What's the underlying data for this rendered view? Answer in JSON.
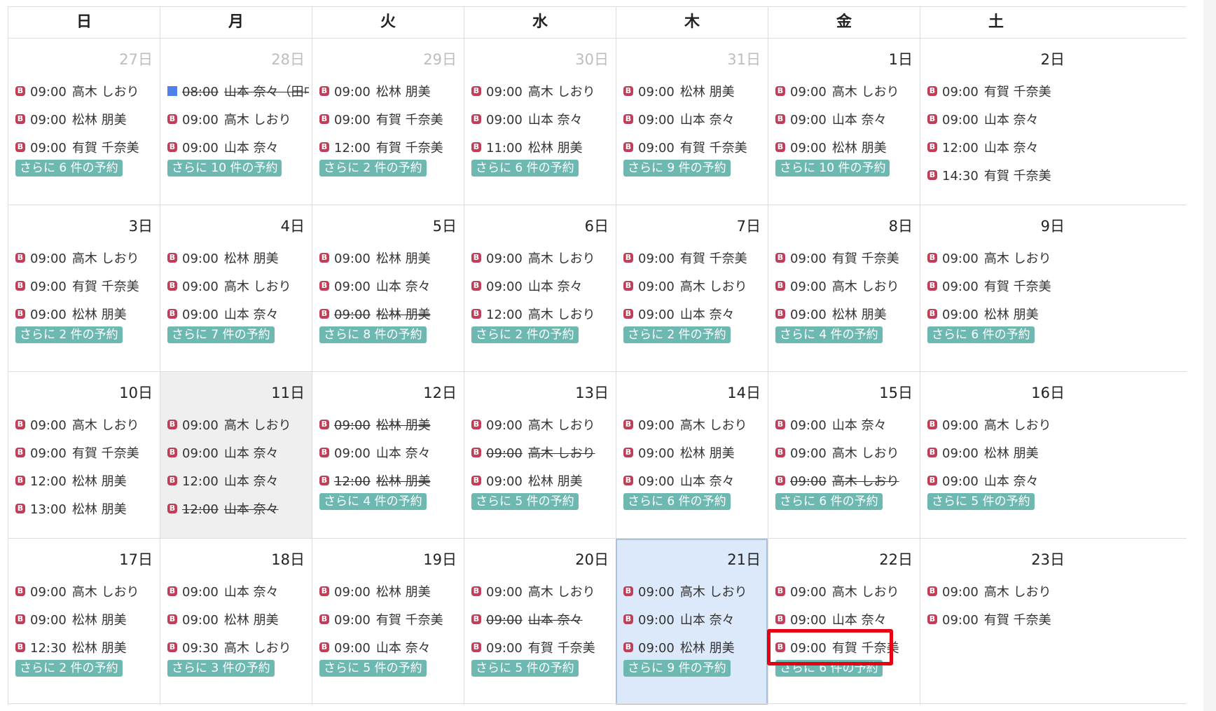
{
  "weekdays": [
    "日",
    "月",
    "火",
    "水",
    "木",
    "金",
    "土"
  ],
  "weeks": [
    [
      {
        "day": "27日",
        "other": true,
        "events": [
          {
            "icon": "b",
            "time": "09:00",
            "name": "高木 しおり"
          },
          {
            "icon": "b",
            "time": "09:00",
            "name": "松林 朋美"
          },
          {
            "icon": "b",
            "time": "09:00",
            "name": "有賀 千奈美"
          }
        ],
        "more": "さらに 6 件の予約"
      },
      {
        "day": "28日",
        "other": true,
        "events": [
          {
            "icon": "sq",
            "time": "08:00",
            "name": "山本 奈々（田中三",
            "cancelled": true
          },
          {
            "icon": "b",
            "time": "09:00",
            "name": "高木 しおり"
          },
          {
            "icon": "b",
            "time": "09:00",
            "name": "山本 奈々"
          }
        ],
        "more": "さらに 10 件の予約"
      },
      {
        "day": "29日",
        "other": true,
        "events": [
          {
            "icon": "b",
            "time": "09:00",
            "name": "松林 朋美"
          },
          {
            "icon": "b",
            "time": "09:00",
            "name": "有賀 千奈美"
          },
          {
            "icon": "b",
            "time": "12:00",
            "name": "有賀 千奈美"
          }
        ],
        "more": "さらに 2 件の予約"
      },
      {
        "day": "30日",
        "other": true,
        "events": [
          {
            "icon": "b",
            "time": "09:00",
            "name": "高木 しおり"
          },
          {
            "icon": "b",
            "time": "09:00",
            "name": "山本 奈々"
          },
          {
            "icon": "b",
            "time": "11:00",
            "name": "松林 朋美"
          }
        ],
        "more": "さらに 6 件の予約"
      },
      {
        "day": "31日",
        "other": true,
        "events": [
          {
            "icon": "b",
            "time": "09:00",
            "name": "松林 朋美"
          },
          {
            "icon": "b",
            "time": "09:00",
            "name": "山本 奈々"
          },
          {
            "icon": "b",
            "time": "09:00",
            "name": "有賀 千奈美"
          }
        ],
        "more": "さらに 9 件の予約"
      },
      {
        "day": "1日",
        "events": [
          {
            "icon": "b",
            "time": "09:00",
            "name": "高木 しおり"
          },
          {
            "icon": "b",
            "time": "09:00",
            "name": "山本 奈々"
          },
          {
            "icon": "b",
            "time": "09:00",
            "name": "松林 朋美"
          }
        ],
        "more": "さらに 10 件の予約"
      },
      {
        "day": "2日",
        "events": [
          {
            "icon": "b",
            "time": "09:00",
            "name": "有賀 千奈美"
          },
          {
            "icon": "b",
            "time": "09:00",
            "name": "山本 奈々"
          },
          {
            "icon": "b",
            "time": "12:00",
            "name": "山本 奈々"
          },
          {
            "icon": "b",
            "time": "14:30",
            "name": "有賀 千奈美"
          }
        ]
      }
    ],
    [
      {
        "day": "3日",
        "events": [
          {
            "icon": "b",
            "time": "09:00",
            "name": "高木 しおり"
          },
          {
            "icon": "b",
            "time": "09:00",
            "name": "有賀 千奈美"
          },
          {
            "icon": "b",
            "time": "09:00",
            "name": "松林 朋美"
          }
        ],
        "more": "さらに 2 件の予約"
      },
      {
        "day": "4日",
        "events": [
          {
            "icon": "b",
            "time": "09:00",
            "name": "松林 朋美"
          },
          {
            "icon": "b",
            "time": "09:00",
            "name": "高木 しおり"
          },
          {
            "icon": "b",
            "time": "09:00",
            "name": "山本 奈々"
          }
        ],
        "more": "さらに 7 件の予約"
      },
      {
        "day": "5日",
        "events": [
          {
            "icon": "b",
            "time": "09:00",
            "name": "松林 朋美"
          },
          {
            "icon": "b",
            "time": "09:00",
            "name": "山本 奈々"
          },
          {
            "icon": "b",
            "time": "09:00",
            "name": "松林 朋美",
            "cancelled": true
          }
        ],
        "more": "さらに 8 件の予約"
      },
      {
        "day": "6日",
        "events": [
          {
            "icon": "b",
            "time": "09:00",
            "name": "高木 しおり"
          },
          {
            "icon": "b",
            "time": "09:00",
            "name": "山本 奈々"
          },
          {
            "icon": "b",
            "time": "12:00",
            "name": "高木 しおり"
          }
        ],
        "more": "さらに 2 件の予約"
      },
      {
        "day": "7日",
        "events": [
          {
            "icon": "b",
            "time": "09:00",
            "name": "有賀 千奈美"
          },
          {
            "icon": "b",
            "time": "09:00",
            "name": "高木 しおり"
          },
          {
            "icon": "b",
            "time": "09:00",
            "name": "山本 奈々"
          }
        ],
        "more": "さらに 2 件の予約"
      },
      {
        "day": "8日",
        "events": [
          {
            "icon": "b",
            "time": "09:00",
            "name": "有賀 千奈美"
          },
          {
            "icon": "b",
            "time": "09:00",
            "name": "高木 しおり"
          },
          {
            "icon": "b",
            "time": "09:00",
            "name": "松林 朋美"
          }
        ],
        "more": "さらに 4 件の予約"
      },
      {
        "day": "9日",
        "events": [
          {
            "icon": "b",
            "time": "09:00",
            "name": "高木 しおり"
          },
          {
            "icon": "b",
            "time": "09:00",
            "name": "有賀 千奈美"
          },
          {
            "icon": "b",
            "time": "09:00",
            "name": "松林 朋美"
          }
        ],
        "more": "さらに 6 件の予約"
      }
    ],
    [
      {
        "day": "10日",
        "events": [
          {
            "icon": "b",
            "time": "09:00",
            "name": "高木 しおり"
          },
          {
            "icon": "b",
            "time": "09:00",
            "name": "有賀 千奈美"
          },
          {
            "icon": "b",
            "time": "12:00",
            "name": "松林 朋美"
          },
          {
            "icon": "b",
            "time": "13:00",
            "name": "松林 朋美"
          }
        ]
      },
      {
        "day": "11日",
        "selected": true,
        "events": [
          {
            "icon": "b",
            "time": "09:00",
            "name": "高木 しおり"
          },
          {
            "icon": "b",
            "time": "09:00",
            "name": "山本 奈々"
          },
          {
            "icon": "b",
            "time": "12:00",
            "name": "山本 奈々"
          },
          {
            "icon": "b",
            "time": "12:00",
            "name": "山本 奈々",
            "cancelled": true
          }
        ]
      },
      {
        "day": "12日",
        "events": [
          {
            "icon": "b",
            "time": "09:00",
            "name": "松林 朋美",
            "cancelled": true
          },
          {
            "icon": "b",
            "time": "09:00",
            "name": "山本 奈々"
          },
          {
            "icon": "b",
            "time": "12:00",
            "name": "松林 朋美",
            "cancelled": true
          }
        ],
        "more": "さらに 4 件の予約"
      },
      {
        "day": "13日",
        "events": [
          {
            "icon": "b",
            "time": "09:00",
            "name": "高木 しおり"
          },
          {
            "icon": "b",
            "time": "09:00",
            "name": "高木 しおり",
            "cancelled": true
          },
          {
            "icon": "b",
            "time": "09:00",
            "name": "松林 朋美"
          }
        ],
        "more": "さらに 5 件の予約"
      },
      {
        "day": "14日",
        "events": [
          {
            "icon": "b",
            "time": "09:00",
            "name": "高木 しおり"
          },
          {
            "icon": "b",
            "time": "09:00",
            "name": "松林 朋美"
          },
          {
            "icon": "b",
            "time": "09:00",
            "name": "山本 奈々"
          }
        ],
        "more": "さらに 6 件の予約"
      },
      {
        "day": "15日",
        "events": [
          {
            "icon": "b",
            "time": "09:00",
            "name": "山本 奈々"
          },
          {
            "icon": "b",
            "time": "09:00",
            "name": "高木 しおり"
          },
          {
            "icon": "b",
            "time": "09:00",
            "name": "高木 しおり",
            "cancelled": true
          }
        ],
        "more": "さらに 6 件の予約"
      },
      {
        "day": "16日",
        "events": [
          {
            "icon": "b",
            "time": "09:00",
            "name": "高木 しおり"
          },
          {
            "icon": "b",
            "time": "09:00",
            "name": "松林 朋美"
          },
          {
            "icon": "b",
            "time": "09:00",
            "name": "山本 奈々"
          }
        ],
        "more": "さらに 5 件の予約"
      }
    ],
    [
      {
        "day": "17日",
        "events": [
          {
            "icon": "b",
            "time": "09:00",
            "name": "高木 しおり"
          },
          {
            "icon": "b",
            "time": "09:00",
            "name": "松林 朋美"
          },
          {
            "icon": "b",
            "time": "12:30",
            "name": "松林 朋美"
          }
        ],
        "more": "さらに 2 件の予約"
      },
      {
        "day": "18日",
        "events": [
          {
            "icon": "b",
            "time": "09:00",
            "name": "山本 奈々"
          },
          {
            "icon": "b",
            "time": "09:00",
            "name": "松林 朋美"
          },
          {
            "icon": "b",
            "time": "09:30",
            "name": "高木 しおり"
          }
        ],
        "more": "さらに 3 件の予約"
      },
      {
        "day": "19日",
        "events": [
          {
            "icon": "b",
            "time": "09:00",
            "name": "松林 朋美"
          },
          {
            "icon": "b",
            "time": "09:00",
            "name": "有賀 千奈美"
          },
          {
            "icon": "b",
            "time": "09:00",
            "name": "山本 奈々"
          }
        ],
        "more": "さらに 5 件の予約"
      },
      {
        "day": "20日",
        "events": [
          {
            "icon": "b",
            "time": "09:00",
            "name": "高木 しおり"
          },
          {
            "icon": "b",
            "time": "09:00",
            "name": "山本 奈々",
            "cancelled": true
          },
          {
            "icon": "b",
            "time": "09:00",
            "name": "有賀 千奈美"
          }
        ],
        "more": "さらに 5 件の予約"
      },
      {
        "day": "21日",
        "today": true,
        "events": [
          {
            "icon": "b",
            "time": "09:00",
            "name": "高木 しおり"
          },
          {
            "icon": "b",
            "time": "09:00",
            "name": "山本 奈々"
          },
          {
            "icon": "b",
            "time": "09:00",
            "name": "松林 朋美"
          }
        ],
        "more": "さらに 9 件の予約"
      },
      {
        "day": "22日",
        "events": [
          {
            "icon": "b",
            "time": "09:00",
            "name": "高木 しおり"
          },
          {
            "icon": "b",
            "time": "09:00",
            "name": "山本 奈々"
          },
          {
            "icon": "b",
            "time": "09:00",
            "name": "有賀 千奈美",
            "highlighted": true
          }
        ],
        "more": "さらに 6 件の予約"
      },
      {
        "day": "23日",
        "events": [
          {
            "icon": "b",
            "time": "09:00",
            "name": "高木 しおり"
          },
          {
            "icon": "b",
            "time": "09:00",
            "name": "有賀 千奈美"
          }
        ]
      }
    ]
  ],
  "colors": {
    "booking_icon": "#c03e58",
    "more_badge": "#6db8b1",
    "today_bg": "#dce9fb",
    "selected_bg": "#efefef",
    "highlight_border": "#e60012",
    "blocked_marker": "#4f7fe8"
  }
}
